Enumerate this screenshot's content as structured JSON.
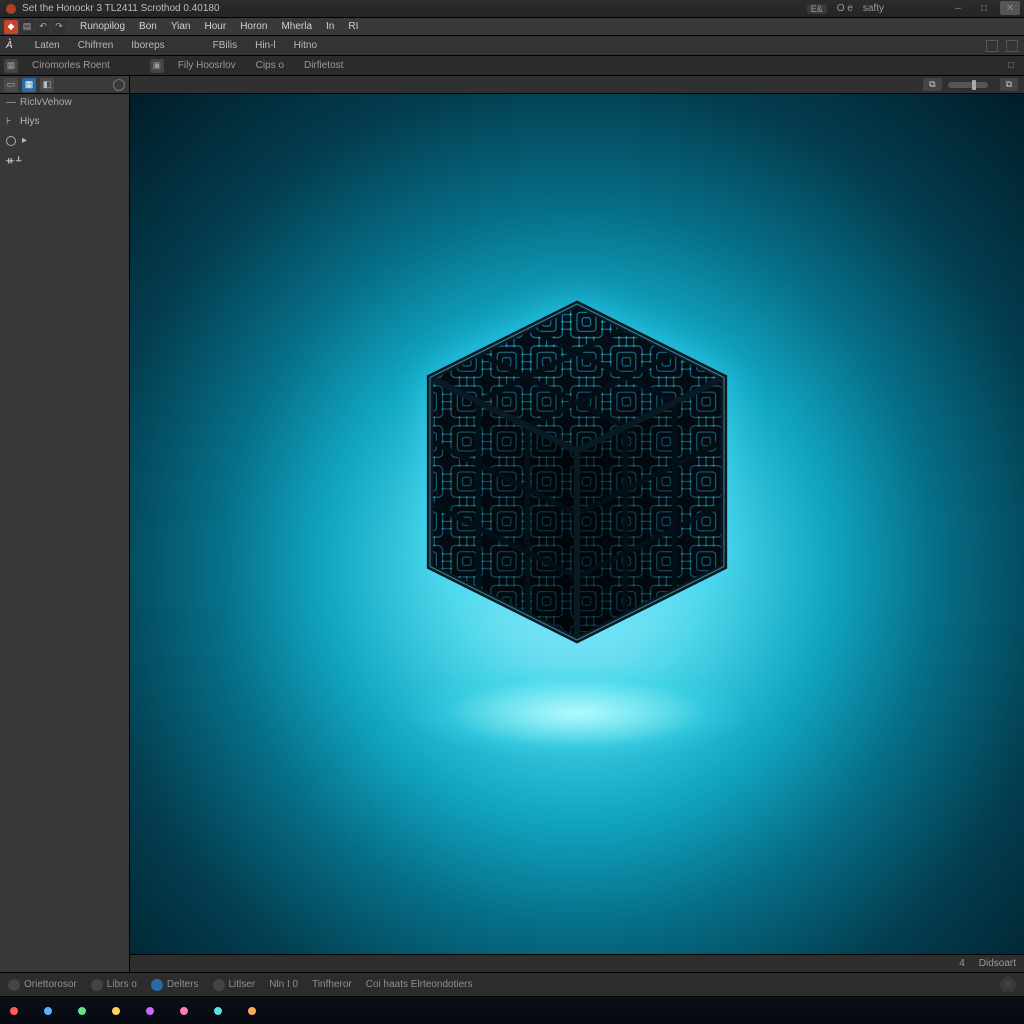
{
  "titlebar": {
    "text": "Set the  Honockr 3   TL2411   Scrothod  0.40180",
    "win": {
      "min": "–",
      "max": "□",
      "close": "✕"
    },
    "extras": {
      "a": "E&",
      "b": "O e",
      "c": "safty"
    }
  },
  "menubar": {
    "items": [
      "Runopilog",
      "Bon",
      "Yian",
      "Hour",
      "Horon",
      "Mherla",
      "In",
      "RI"
    ]
  },
  "optionsbar": {
    "lead": "A͛",
    "items": [
      "Laten",
      "Chifrren",
      "Iboreps",
      "FBilis",
      "Hin-l",
      "Hitno"
    ]
  },
  "tabstrip": {
    "left_label": "Ciromorles Roent",
    "tabs": [
      "Fily Hoosrlov",
      "Cips o",
      "Dirfietost"
    ]
  },
  "leftpanel": {
    "row1_label": "▦",
    "header": "RiclvVehow",
    "line1": "Hiys"
  },
  "canvas_header": {
    "chip1": "⧉",
    "chip2": "⧉"
  },
  "canvas_footer": {
    "left_num": "4",
    "right_label": "Didsoart"
  },
  "statusbar": {
    "items": [
      "Oriettorosor",
      "Librs о",
      "Delters",
      "Litlser",
      "Nln I 0",
      "Tinfheror",
      "Coi haats  Elrteondotiers"
    ]
  },
  "colors": {
    "accent": "#2a6aa6",
    "glow": "#4fd7ea"
  }
}
